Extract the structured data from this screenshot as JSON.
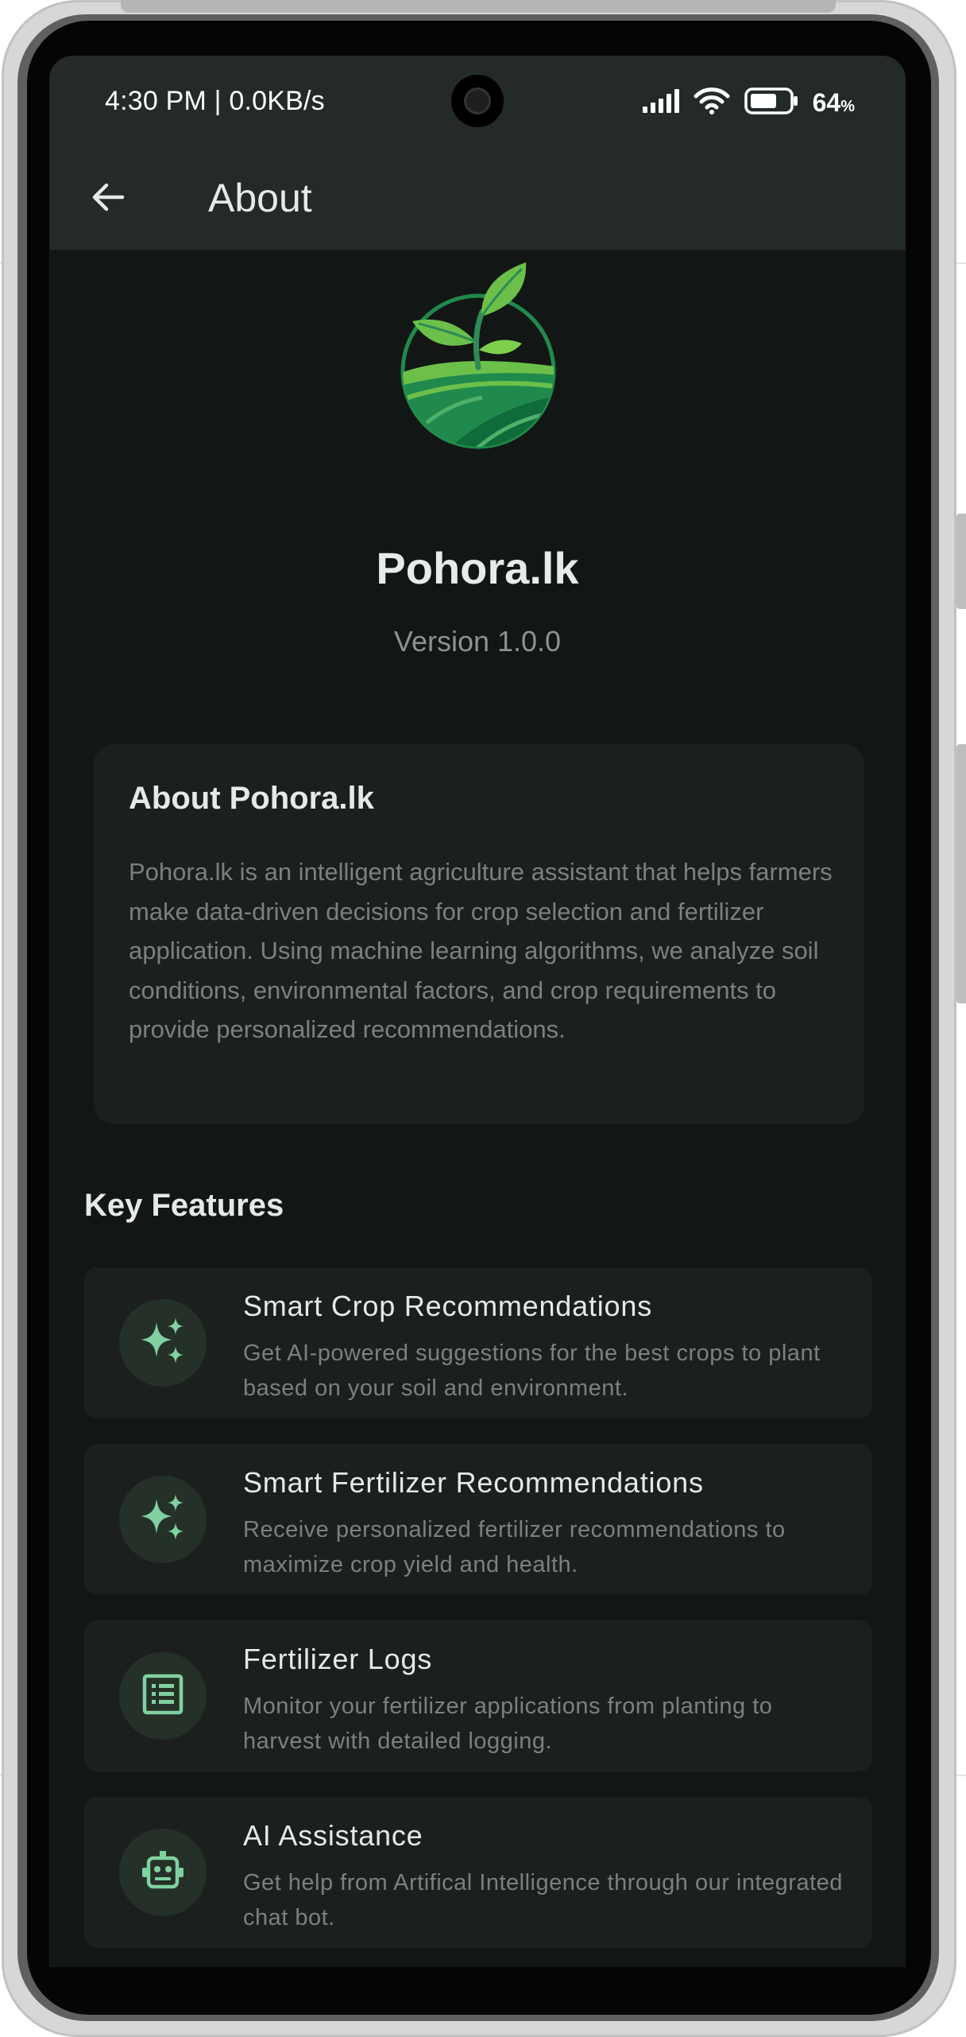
{
  "status_bar": {
    "time": "4:30 PM | 0.0KB/s",
    "battery_percent": "64",
    "battery_unit": "%",
    "icons": [
      "signal-icon",
      "wifi-icon",
      "battery-icon"
    ]
  },
  "app_bar": {
    "back_icon": "arrow-left-icon",
    "title": "About"
  },
  "app_info": {
    "name": "Pohora.lk",
    "version": "Version 1.0.0"
  },
  "about": {
    "title": "About Pohora.lk",
    "text": "Pohora.lk is an intelligent agriculture assistant that helps farmers make data-driven decisions for crop selection and fertilizer application. Using machine learning algorithms, we analyze soil conditions, environmental factors, and crop requirements to provide personalized recommendations."
  },
  "features": {
    "title": "Key Features",
    "items": [
      {
        "icon": "sparkles-icon",
        "title": "Smart Crop Recommendations",
        "description": "Get AI-powered suggestions for the best crops to plant based on your soil and environment."
      },
      {
        "icon": "sparkles-icon",
        "title": "Smart Fertilizer Recommendations",
        "description": "Receive personalized fertilizer recommendations to maximize crop yield and health."
      },
      {
        "icon": "list-document-icon",
        "title": "Fertilizer Logs",
        "description": "Monitor your fertilizer applications from planting to harvest with detailed logging."
      },
      {
        "icon": "robot-icon",
        "title": "AI Assistance",
        "description": "Get help from Artifical Intelligence through our integrated chat bot."
      }
    ]
  },
  "colors": {
    "background": "#121715",
    "app_bar": "#232a27",
    "card": "#1b201e",
    "accent_green": "#7fd1a0",
    "icon_circle": "#253029"
  }
}
